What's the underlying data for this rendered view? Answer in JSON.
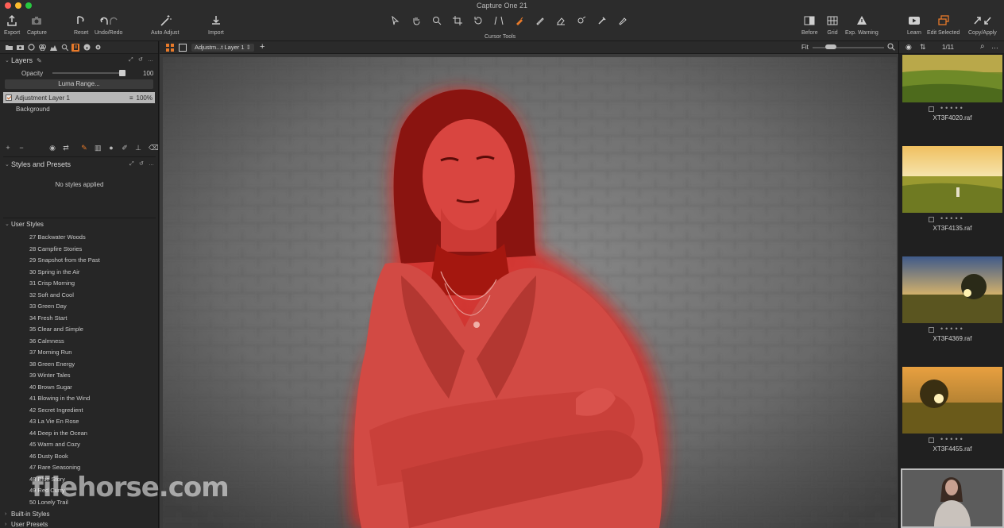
{
  "window": {
    "title": "Capture One 21"
  },
  "toolbar": {
    "export": "Export",
    "capture": "Capture",
    "reset": "Reset",
    "undo_redo": "Undo/Redo",
    "auto_adjust": "Auto Adjust",
    "import": "Import",
    "cursor_tools": "Cursor Tools",
    "before": "Before",
    "grid": "Grid",
    "exp_warning": "Exp. Warning",
    "learn": "Learn",
    "edit_selected": "Edit Selected",
    "copy_apply": "Copy/Apply"
  },
  "layers": {
    "title": "Layers",
    "opacity_label": "Opacity",
    "opacity_value": "100",
    "luma_range": "Luma Range...",
    "items": [
      {
        "name": "Adjustment Layer 1",
        "opacity": "100%",
        "selected": true
      },
      {
        "name": "Background"
      }
    ]
  },
  "styles": {
    "title": "Styles and Presets",
    "status": "No styles applied",
    "user_styles": "User Styles",
    "items": [
      "27 Backwater Woods",
      "28 Campfire Stories",
      "29 Snapshot from the Past",
      "30 Spring in the Air",
      "31 Crisp Morning",
      "32 Soft and Cool",
      "33 Green Day",
      "34 Fresh Start",
      "35 Clear and Simple",
      "36 Calmness",
      "37 Morning Run",
      "38 Green Energy",
      "39 Winter Tales",
      "40 Brown Sugar",
      "41 Blowing in the Wind",
      "42 Secret Ingredient",
      "43 La Vie En Rose",
      "44 Deep in the Ocean",
      "45 Warm and Cozy",
      "46 Dusty Book",
      "47 Rare Seasoning",
      "48 Blue Story",
      "49 Red Curry",
      "50 Lonely Trail"
    ],
    "built_in": "Built-in Styles",
    "user_presets": "User Presets"
  },
  "viewer": {
    "layer_select": "Adjustm...t Layer 1",
    "fit": "Fit"
  },
  "filmstrip": {
    "counter": "1/11",
    "items": [
      {
        "name": "XT3F4020.raf"
      },
      {
        "name": "XT3F4135.raf"
      },
      {
        "name": "XT3F4369.raf"
      },
      {
        "name": "XT3F4455.raf"
      }
    ]
  },
  "watermark": "filehorse.com",
  "colors": {
    "accent": "#e87a2a",
    "mask": "#e2322e"
  }
}
